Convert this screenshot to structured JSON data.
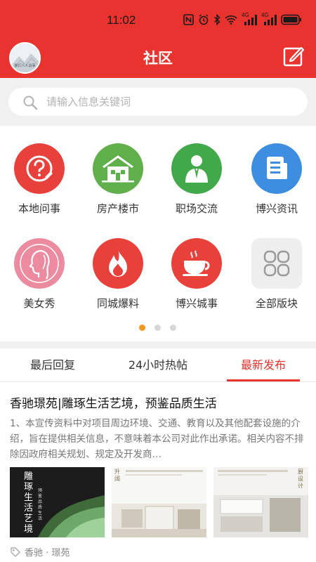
{
  "status_bar": {
    "time": "11:02",
    "signal1": "4G",
    "signal2": "4G"
  },
  "header": {
    "title": "社区",
    "avatar_text": "我们人人说事"
  },
  "search": {
    "placeholder": "请输入信息关键词"
  },
  "categories": [
    {
      "label": "本地问事",
      "icon": "question-icon",
      "color": "#e8403a"
    },
    {
      "label": "房产楼市",
      "icon": "house-icon",
      "color": "#5fb04a"
    },
    {
      "label": "职场交流",
      "icon": "businessman-icon",
      "color": "#42a94a"
    },
    {
      "label": "博兴资讯",
      "icon": "document-icon",
      "color": "#3d8de0"
    },
    {
      "label": "美女秀",
      "icon": "woman-profile-icon",
      "color": "#ec8aa0"
    },
    {
      "label": "同城爆料",
      "icon": "flame-icon",
      "color": "#e8403a"
    },
    {
      "label": "博兴城事",
      "icon": "teacup-icon",
      "color": "#e8403a"
    },
    {
      "label": "全部版块",
      "icon": "grid-icon",
      "color": "#eeeeee"
    }
  ],
  "pager": {
    "pages": 3,
    "active": 0
  },
  "tabs": [
    {
      "label": "最后回复"
    },
    {
      "label": "24小时热帖"
    },
    {
      "label": "最新发布"
    }
  ],
  "post": {
    "title": "香驰璟苑|雕琢生活艺境，预鉴品质生活",
    "description": "1、本宣传资料中对项目周边环境、交通、教育以及其他配套设施的介绍，旨在提供相关信息，不意味着本公司对此作出承诺。相关内容不排除因政府相关规划、规定及开发商…",
    "thumb1_text": "雕琢生活艺境",
    "thumb1_sub": "预鉴品质生活",
    "thumb2_text": "升阔",
    "thumb3_text": "厨设计",
    "tag": "香驰 · 璟苑"
  }
}
